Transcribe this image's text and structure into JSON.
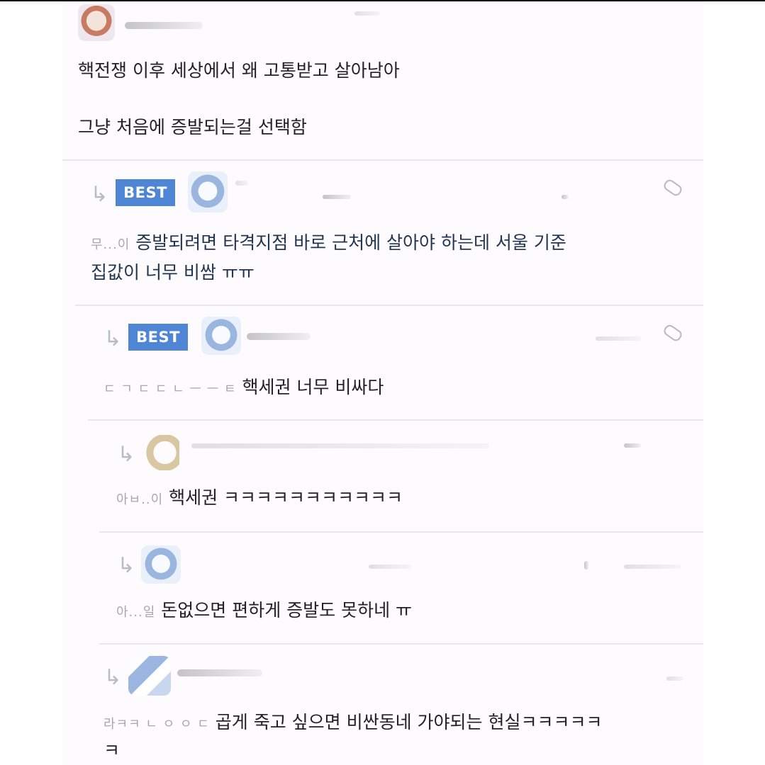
{
  "post": {
    "line1": "핵전쟁 이후 세상에서 왜 고통받고 살아남아",
    "line2": "그냥 처음에 증발되는걸 선택함"
  },
  "replies": [
    {
      "badge": "BEST",
      "mask": "무...이",
      "line1": "증발되려면 타격지점 바로 근처에 살아야 하는데 서울 기준",
      "line2": "집값이 너무 비쌈 ㅠㅠ"
    },
    {
      "badge": "BEST",
      "mask": "ㄷ ㄱ ㄷ ㄷ ㄴ ㅡ ㅡ ㅌ",
      "text": "핵세권 너무 비싸다"
    },
    {
      "mask": "아ㅂ..이",
      "text": "핵세권 ㅋㅋㅋㅋㅋㅋㅋㅋㅋㅋㅋ"
    },
    {
      "mask": "아...일",
      "text": "돈없으면 편하게 증발도 못하네 ㅠ"
    },
    {
      "mask": "라ㅋㅋ ㄴ ㅇ ㅇ ㄷ",
      "line1": "곱게 죽고 싶으면 비싼동네 가야되는 현실ㅋㅋㅋㅋㅋ",
      "line2": "ㅋ"
    }
  ],
  "icons": {
    "reply": "reply-arrow-icon",
    "link": "link-icon",
    "avatar": "avatar"
  },
  "colors": {
    "best_badge": "#4e86d5",
    "background": "#fdfbfe",
    "divider": "#e9e7ed"
  }
}
